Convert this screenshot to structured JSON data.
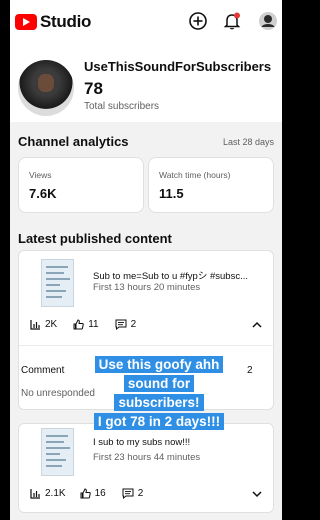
{
  "app": {
    "name": "Studio",
    "brand_color": "#ff0000"
  },
  "header": {
    "icons": [
      "add-icon",
      "notification-bell-icon",
      "account-avatar-icon"
    ],
    "notification_dot_color": "#e53935"
  },
  "channel": {
    "name": "UseThisSoundForSubscribers",
    "subscribers": "78",
    "subscribers_label": "Total subscribers"
  },
  "analytics": {
    "title": "Channel analytics",
    "range": "Last 28 days",
    "views": {
      "label": "Views",
      "value": "7.6K"
    },
    "watch_time": {
      "label": "Watch time (hours)",
      "value": "11.5"
    }
  },
  "latest": {
    "title": "Latest published content",
    "videos": [
      {
        "title": "Sub to me=Sub to u #fypシ #subsc...",
        "meta": "First 13 hours 20 minutes",
        "views": "2K",
        "likes": "11",
        "comments": "2"
      },
      {
        "title": "I sub to my subs now!!!",
        "meta": "First 23 hours 44 minutes",
        "views": "2.1K",
        "likes": "16",
        "comments": "2"
      }
    ],
    "comments_label": "Comment",
    "comments_count": "2",
    "comments_empty": "No unresponded"
  },
  "overlay_caption": [
    "Use this goofy ahh",
    "sound for",
    "subscribers!",
    "I got 78 in 2 days!!!"
  ],
  "overlay_color": "#2f8fe5"
}
